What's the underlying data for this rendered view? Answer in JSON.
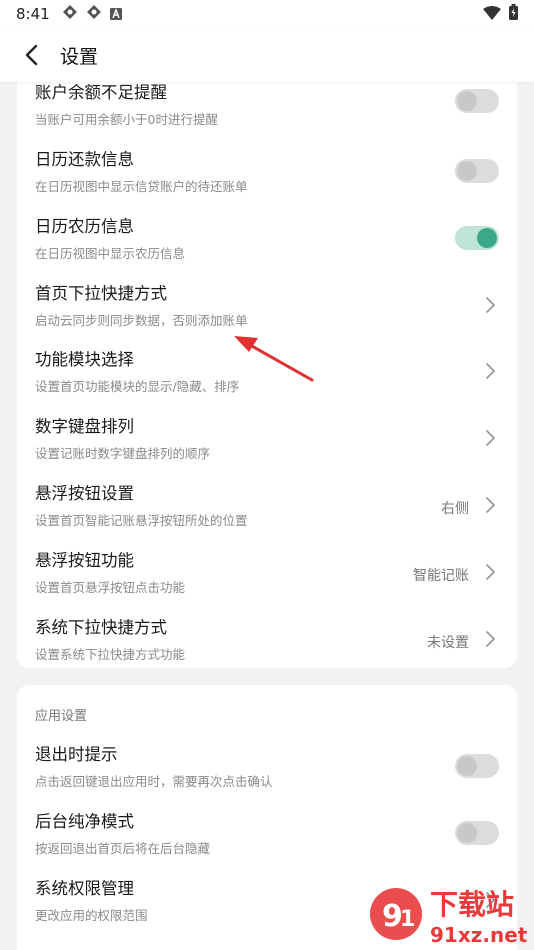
{
  "status": {
    "time": "8:41"
  },
  "header": {
    "title": "设置"
  },
  "main_rows": [
    {
      "title": "账户余额不足提醒",
      "subtitle": "当账户可用余额小于0时进行提醒",
      "control": "toggle",
      "on": false
    },
    {
      "title": "日历还款信息",
      "subtitle": "在日历视图中显示信贷账户的待还账单",
      "control": "toggle",
      "on": false
    },
    {
      "title": "日历农历信息",
      "subtitle": "在日历视图中显示农历信息",
      "control": "toggle",
      "on": true
    },
    {
      "title": "首页下拉快捷方式",
      "subtitle": "启动云同步则同步数据，否则添加账单",
      "control": "chevron",
      "value": ""
    },
    {
      "title": "功能模块选择",
      "subtitle": "设置首页功能模块的显示/隐藏、排序",
      "control": "chevron",
      "value": ""
    },
    {
      "title": "数字键盘排列",
      "subtitle": "设置记账时数字键盘排列的顺序",
      "control": "chevron",
      "value": ""
    },
    {
      "title": "悬浮按钮设置",
      "subtitle": "设置首页智能记账悬浮按钮所处的位置",
      "control": "chevron",
      "value": "右侧"
    },
    {
      "title": "悬浮按钮功能",
      "subtitle": "设置首页悬浮按钮点击功能",
      "control": "chevron",
      "value": "智能记账"
    },
    {
      "title": "系统下拉快捷方式",
      "subtitle": "设置系统下拉快捷方式功能",
      "control": "chevron",
      "value": "未设置"
    }
  ],
  "app_section": {
    "label": "应用设置",
    "rows": [
      {
        "title": "退出时提示",
        "subtitle": "点击返回键退出应用时，需要再次点击确认",
        "control": "toggle",
        "on": false
      },
      {
        "title": "后台纯净模式",
        "subtitle": "按返回退出首页后将在后台隐藏",
        "control": "toggle",
        "on": false
      },
      {
        "title": "系统权限管理",
        "subtitle": "更改应用的权限范围",
        "control": "chevron",
        "value": ""
      }
    ]
  },
  "watermark": {
    "brand": "下载站",
    "domain": "91xz.net"
  },
  "colors": {
    "accent": "#3aa98a",
    "annotation_arrow": "#e03030"
  }
}
